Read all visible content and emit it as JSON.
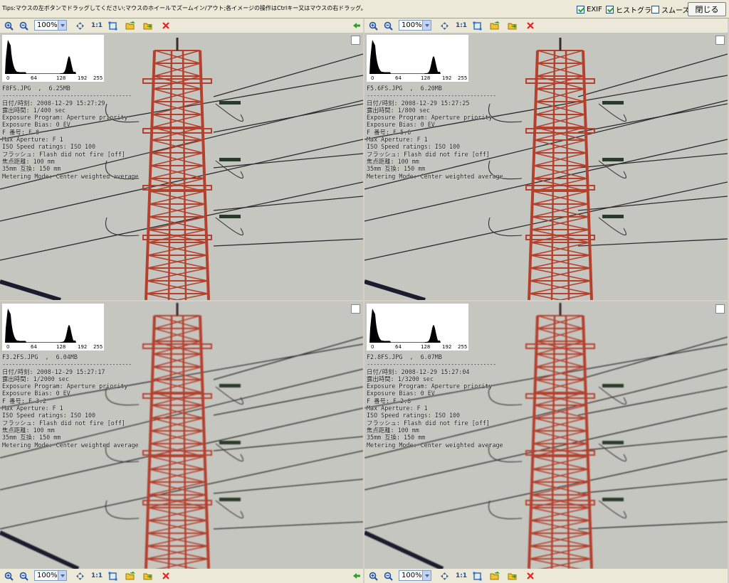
{
  "tips": "Tips:マウスの左ボタンでドラッグしてください;マウスのホイールでズームイン/アウト;各イメージの操作はCtrlキー又はマウスの右ドラッグ。",
  "options": {
    "exif_label": "EXIF",
    "exif_checked": true,
    "histogram_label": "ヒストグラ",
    "histogram_checked": true,
    "smooth_label": "スムーズ",
    "smooth_checked": false,
    "close_label": "閉じる"
  },
  "toolbar": {
    "zoom_value": "100%",
    "actual_size_label": "1:1"
  },
  "histogram_ticks": [
    "0",
    "64",
    "128",
    "192",
    "255"
  ],
  "separator": "----------------------------------------",
  "panes": [
    {
      "file": "F8FS.JPG  ,  6.25MB",
      "date": "日付/時刻: 2008-12-29 15:27:29",
      "exposure": "露出時間: 1/400 sec",
      "program": "Exposure Program: Aperture priority",
      "bias": "Exposure Bias: 0 EV",
      "fnumber": "F 番号: F 8",
      "max_aperture": "Max Aperture: F 1",
      "iso": "ISO Speed ratings: ISO 100",
      "flash": "フラッシュ: Flash did not fire [off]",
      "focal": "焦点距離: 100 mm",
      "focal35": "35mm 互換: 150 mm",
      "metering": "Metering Mode: Center weighted average"
    },
    {
      "file": "F5.6FS.JPG  ,  6.20MB",
      "date": "日付/時刻: 2008-12-29 15:27:25",
      "exposure": "露出時間: 1/800 sec",
      "program": "Exposure Program: Aperture priority",
      "bias": "Exposure Bias: 0 EV",
      "fnumber": "F 番号: F 5.6",
      "max_aperture": "Max Aperture: F 1",
      "iso": "ISO Speed ratings: ISO 100",
      "flash": "フラッシュ: Flash did not fire [off]",
      "focal": "焦点距離: 100 mm",
      "focal35": "35mm 互換: 150 mm",
      "metering": "Metering Mode: Center weighted average"
    },
    {
      "file": "F3.2FS.JPG  ,  6.04MB",
      "date": "日付/時刻: 2008-12-29 15:27:17",
      "exposure": "露出時間: 1/2000 sec",
      "program": "Exposure Program: Aperture priority",
      "bias": "Exposure Bias: 0 EV",
      "fnumber": "F 番号: F 3.2",
      "max_aperture": "Max Aperture: F 1",
      "iso": "ISO Speed ratings: ISO 100",
      "flash": "フラッシュ: Flash did not fire [off]",
      "focal": "焦点距離: 100 mm",
      "focal35": "35mm 互換: 150 mm",
      "metering": "Metering Mode: Center weighted average"
    },
    {
      "file": "F2.8FS.JPG  ,  6.07MB",
      "date": "日付/時刻: 2008-12-29 15:27:04",
      "exposure": "露出時間: 1/3200 sec",
      "program": "Exposure Program: Aperture priority",
      "bias": "Exposure Bias: 0 EV",
      "fnumber": "F 番号: F 2.8",
      "max_aperture": "Max Aperture: F 1",
      "iso": "ISO Speed ratings: ISO 100",
      "flash": "フラッシュ: Flash did not fire [off]",
      "focal": "焦点距離: 100 mm",
      "focal35": "35mm 互換: 150 mm",
      "metering": "Metering Mode: Center weighted average"
    }
  ],
  "colors": {
    "tower": "#b4412e",
    "sky": "#c6c6c0",
    "toolbar": "#ece9d8"
  }
}
